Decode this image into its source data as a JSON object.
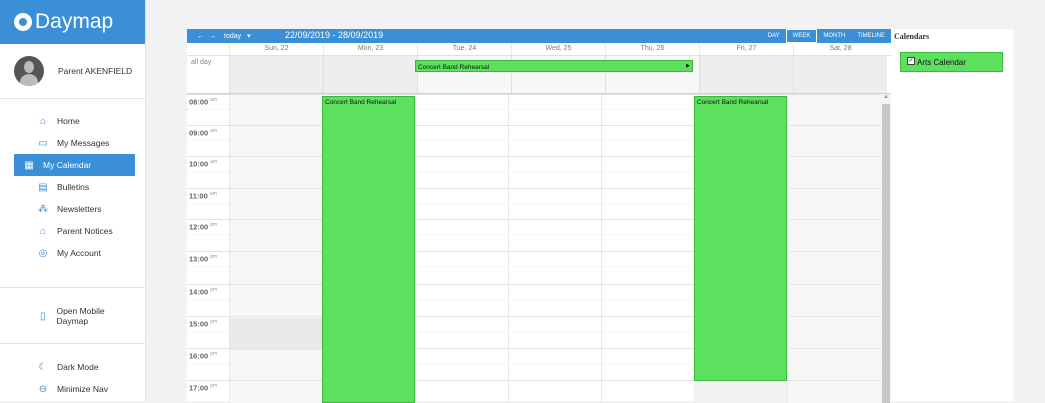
{
  "app": {
    "logo_text": "Daymap",
    "brand_color": "#3a8fd6",
    "event_color": "#5de05d"
  },
  "user": {
    "name": "Parent AKENFIELD"
  },
  "nav": {
    "items": [
      {
        "label": "Home",
        "icon": "home-icon"
      },
      {
        "label": "My Messages",
        "icon": "message-icon"
      },
      {
        "label": "My Calendar",
        "icon": "calendar-icon",
        "active": true
      },
      {
        "label": "Bulletins",
        "icon": "bulletin-icon"
      },
      {
        "label": "Newsletters",
        "icon": "newsletter-icon"
      },
      {
        "label": "Parent Notices",
        "icon": "notice-icon"
      },
      {
        "label": "My Account",
        "icon": "account-icon"
      }
    ],
    "mobile": {
      "label": "Open Mobile Daymap",
      "icon": "mobile-icon"
    },
    "dark_mode": {
      "label": "Dark Mode",
      "icon": "dark-mode-icon"
    },
    "minimize": {
      "label": "Minimize Nav",
      "icon": "minimize-icon"
    }
  },
  "toolbar": {
    "prev": "←",
    "next": "→",
    "today": "today",
    "today_caret": "▾",
    "range": "22/09/2019 - 28/09/2019",
    "views": [
      "DAY",
      "WEEK",
      "MONTH",
      "TIMELINE"
    ],
    "selected_view": "WEEK"
  },
  "days": [
    "Sun, 22",
    "Mon, 23",
    "Tue, 24",
    "Wed, 25",
    "Thu, 26",
    "Fri, 27",
    "Sat, 28"
  ],
  "all_day_label": "all day",
  "all_day_event": {
    "title": "Concert Band Rehearsal",
    "start_day": "Tue, 24",
    "end_day": "Thu, 26"
  },
  "times": [
    {
      "hour": "08:00",
      "ampm": "am"
    },
    {
      "hour": "09:00",
      "ampm": "am"
    },
    {
      "hour": "10:00",
      "ampm": "am"
    },
    {
      "hour": "11:00",
      "ampm": "am"
    },
    {
      "hour": "12:00",
      "ampm": "pm"
    },
    {
      "hour": "13:00",
      "ampm": "pm"
    },
    {
      "hour": "14:00",
      "ampm": "pm"
    },
    {
      "hour": "15:00",
      "ampm": "pm"
    },
    {
      "hour": "16:00",
      "ampm": "pm"
    },
    {
      "hour": "17:00",
      "ampm": "pm"
    }
  ],
  "events": [
    {
      "title": "Concert Band Rehearsal",
      "day": "Mon, 23"
    },
    {
      "title": "Concert Band Rehearsal",
      "day": "Fri, 27"
    }
  ],
  "calendars_panel": {
    "title": "Calendars",
    "items": [
      {
        "label": "Arts Calendar",
        "checked": true
      }
    ]
  }
}
